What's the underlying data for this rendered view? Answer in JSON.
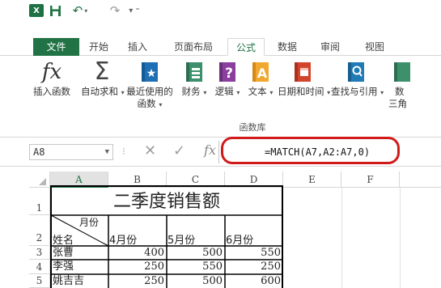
{
  "quick_access": {
    "app_icon": "X",
    "icons": [
      "excel-icon",
      "save-icon",
      "undo-icon",
      "redo-icon",
      "customize-icon"
    ]
  },
  "tabs": [
    "文件",
    "开始",
    "插入",
    "页面布局",
    "公式",
    "数据",
    "审阅",
    "视图"
  ],
  "active_tab": "公式",
  "ribbon": {
    "buttons": [
      {
        "label": "插入函数",
        "icon": "fx-icon"
      },
      {
        "label": "自动求和",
        "icon": "sigma-icon",
        "caret": true
      },
      {
        "label": "最近使用的",
        "label2": "函数",
        "icon": "star-book-icon",
        "caret": true
      },
      {
        "label": "财务",
        "icon": "money-book-icon",
        "caret": true
      },
      {
        "label": "逻辑",
        "icon": "question-book-icon",
        "caret": true
      },
      {
        "label": "文本",
        "icon": "text-book-icon",
        "caret": true
      },
      {
        "label": "日期和时间",
        "icon": "calendar-book-icon",
        "caret": true
      },
      {
        "label": "查找与引用",
        "icon": "search-book-icon",
        "caret": true
      },
      {
        "label": "数",
        "label2": "三角",
        "icon": "math-book-icon"
      }
    ],
    "group_label": "函数库"
  },
  "formula_bar": {
    "name_box": "A8",
    "formula": "=MATCH(A7,A2:A7,0)"
  },
  "sheet": {
    "columns": [
      "A",
      "B",
      "C",
      "D",
      "E",
      "F"
    ],
    "selected_column": "A",
    "rows": [
      "1",
      "2",
      "3",
      "4",
      "5"
    ],
    "title": "二季度销售额",
    "header_diag_top": "月份",
    "header_diag_bottom": "姓名",
    "month_headers": [
      "4月份",
      "5月份",
      "6月份"
    ],
    "data": [
      {
        "name": "张曹",
        "values": [
          "400",
          "500",
          "550"
        ]
      },
      {
        "name": "李强",
        "values": [
          "250",
          "550",
          "250"
        ]
      },
      {
        "name": "姚吉吉",
        "values": [
          "250",
          "500",
          "600"
        ]
      }
    ]
  },
  "colors": {
    "accent": "#217346",
    "highlight": "#d11a1a"
  }
}
